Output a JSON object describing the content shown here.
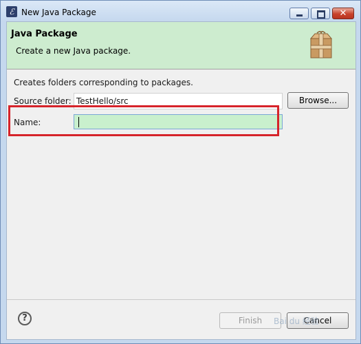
{
  "window": {
    "title": "New Java Package",
    "close_glyph": "✕"
  },
  "header": {
    "title": "Java Package",
    "description": "Create a new Java package."
  },
  "content": {
    "description": "Creates folders corresponding to packages.",
    "source_folder_label": "Source folder:",
    "source_folder_value": "TestHello/src",
    "browse_label": "Browse...",
    "name_label": "Name:",
    "name_value": ""
  },
  "footer": {
    "help_glyph": "?",
    "finish_label": "Finish",
    "cancel_label": "Cancel",
    "watermark": "Bai du 经验"
  },
  "colors": {
    "header_bg": "#cdeccf",
    "name_field_bg": "#c9f0cd",
    "highlight_border": "#d6232a"
  },
  "icons": {
    "app": "eclipse-icon",
    "package": "package-box-icon",
    "help": "help-icon"
  }
}
